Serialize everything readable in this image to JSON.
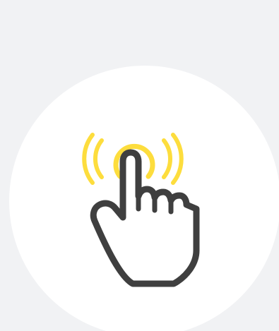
{
  "illustration": {
    "icon": "tap-gesture-icon",
    "parts": [
      "tap-waves-icon",
      "pointing-hand-icon"
    ],
    "colors": {
      "background": "#f1f2f4",
      "circle": "#ffffff",
      "waves": "#fddd3d",
      "hand_stroke": "#3f3f3f",
      "hand_fill": "#ffffff"
    }
  }
}
